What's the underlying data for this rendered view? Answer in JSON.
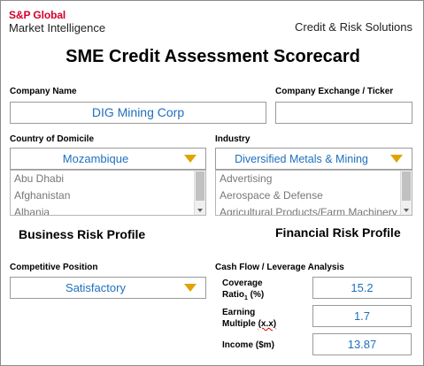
{
  "header": {
    "logo_line1": "S&P Global",
    "logo_line2": "Market Intelligence",
    "right_text": "Credit & Risk Solutions"
  },
  "title": "SME Credit Assessment Scorecard",
  "company_name": {
    "label": "Company Name",
    "value": "DIG Mining Corp"
  },
  "company_exchange": {
    "label": "Company Exchange / Ticker",
    "value": ""
  },
  "country": {
    "label": "Country of Domicile",
    "selected": "Mozambique",
    "list": [
      "Abu Dhabi",
      "Afghanistan",
      "Albania"
    ]
  },
  "industry": {
    "label": "Industry",
    "selected": "Diversified Metals & Mining",
    "list": [
      "Advertising",
      "Aerospace & Defense",
      "Agricultural Products/Farm Machinery"
    ]
  },
  "sections": {
    "business": "Business Risk Profile",
    "financial": "Financial Risk Profile"
  },
  "competitive_position": {
    "label": "Competitive Position",
    "selected": "Satisfactory"
  },
  "cashflow": {
    "label": "Cash Flow / Leverage Analysis",
    "coverage": {
      "label_line1": "Coverage",
      "label_line2_a": "Ratio",
      "label_line2_sub": "1",
      "label_line2_b": " (%)",
      "value": "15.2"
    },
    "earning": {
      "label_line1": "Earning",
      "label_line2_a": "Multiple ",
      "label_line2_b": "(x.x)",
      "value": "1.7"
    },
    "income": {
      "label": "Income ($m)",
      "value": "13.87"
    }
  },
  "colors": {
    "accent_red": "#d6002a",
    "value_blue": "#1f6fbf",
    "dropdown_arrow": "#e0a400"
  }
}
